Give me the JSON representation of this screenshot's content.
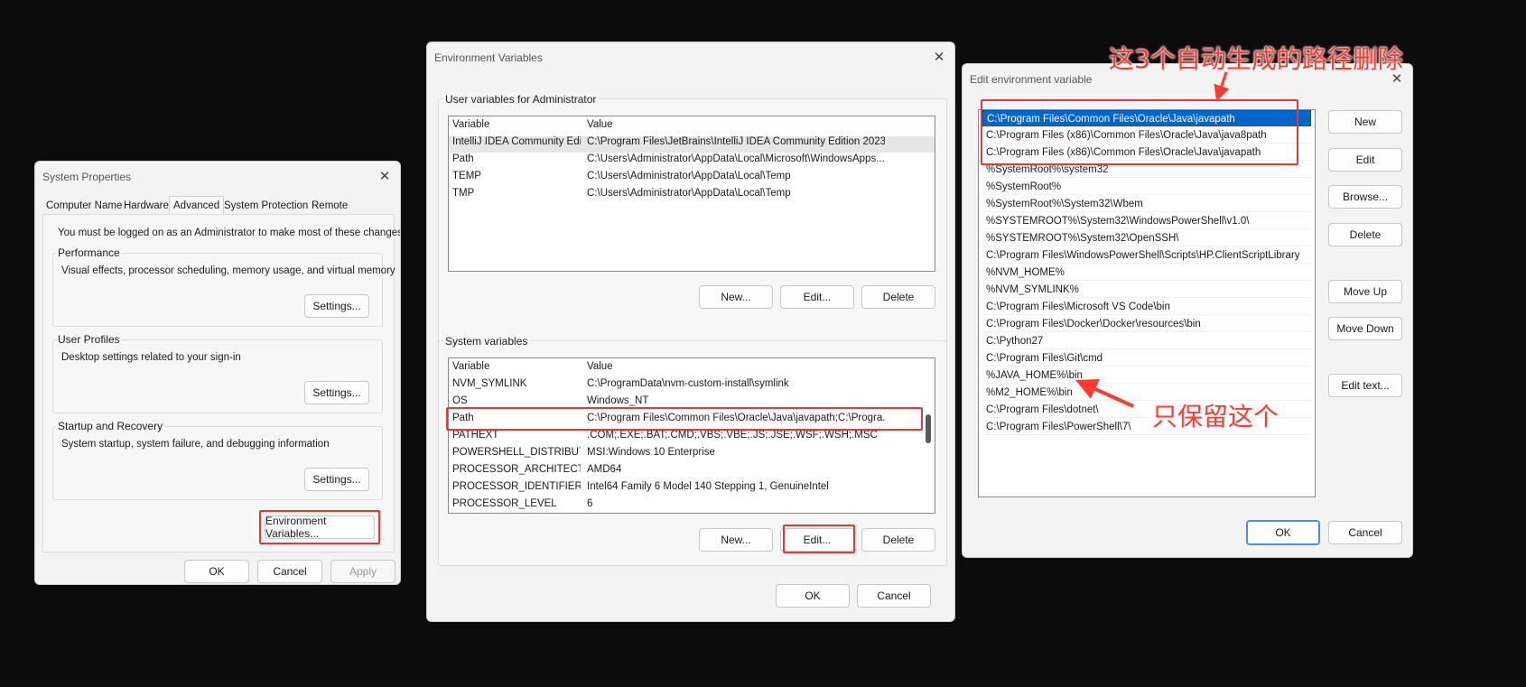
{
  "sys": {
    "title": "System Properties",
    "tabs": [
      "Computer Name",
      "Hardware",
      "Advanced",
      "System Protection",
      "Remote"
    ],
    "admin_note": "You must be logged on as an Administrator to make most of these changes.",
    "perf_label": "Performance",
    "perf_desc": "Visual effects, processor scheduling, memory usage, and virtual memory",
    "profiles_label": "User Profiles",
    "profiles_desc": "Desktop settings related to your sign-in",
    "startup_label": "Startup and Recovery",
    "startup_desc": "System startup, system failure, and debugging information",
    "settings": "Settings...",
    "env_button": "Environment Variables...",
    "ok": "OK",
    "cancel": "Cancel",
    "apply": "Apply"
  },
  "env": {
    "title": "Environment Variables",
    "user_label": "User variables for Administrator",
    "col_variable": "Variable",
    "col_value": "Value",
    "user_vars": [
      {
        "name": "IntelliJ IDEA Community Edi...",
        "value": "C:\\Program Files\\JetBrains\\IntelliJ IDEA Community Edition 2023...."
      },
      {
        "name": "Path",
        "value": "C:\\Users\\Administrator\\AppData\\Local\\Microsoft\\WindowsApps..."
      },
      {
        "name": "TEMP",
        "value": "C:\\Users\\Administrator\\AppData\\Local\\Temp"
      },
      {
        "name": "TMP",
        "value": "C:\\Users\\Administrator\\AppData\\Local\\Temp"
      }
    ],
    "sys_label": "System variables",
    "sys_vars": [
      {
        "name": "NVM_SYMLINK",
        "value": "C:\\ProgramData\\nvm-custom-install\\symlink"
      },
      {
        "name": "OS",
        "value": "Windows_NT"
      },
      {
        "name": "Path",
        "value": "C:\\Program Files\\Common Files\\Oracle\\Java\\javapath;C:\\Progra..."
      },
      {
        "name": "PATHEXT",
        "value": ".COM;.EXE;.BAT;.CMD;.VBS;.VBE;.JS;.JSE;.WSF;.WSH;.MSC"
      },
      {
        "name": "POWERSHELL_DISTRIBUTIO...",
        "value": "MSI:Windows 10 Enterprise"
      },
      {
        "name": "PROCESSOR_ARCHITECTURE",
        "value": "AMD64"
      },
      {
        "name": "PROCESSOR_IDENTIFIER",
        "value": "Intel64 Family 6 Model 140 Stepping 1, GenuineIntel"
      },
      {
        "name": "PROCESSOR_LEVEL",
        "value": "6"
      }
    ],
    "new": "New...",
    "edit": "Edit...",
    "delete": "Delete",
    "ok": "OK",
    "cancel": "Cancel"
  },
  "edit": {
    "title": "Edit environment variable",
    "entries": [
      "C:\\Program Files\\Common Files\\Oracle\\Java\\javapath",
      "C:\\Program Files (x86)\\Common Files\\Oracle\\Java\\java8path",
      "C:\\Program Files (x86)\\Common Files\\Oracle\\Java\\javapath",
      "%SystemRoot%\\system32",
      "%SystemRoot%",
      "%SystemRoot%\\System32\\Wbem",
      "%SYSTEMROOT%\\System32\\WindowsPowerShell\\v1.0\\",
      "%SYSTEMROOT%\\System32\\OpenSSH\\",
      "C:\\Program Files\\WindowsPowerShell\\Scripts\\HP.ClientScriptLibrary",
      "%NVM_HOME%",
      "%NVM_SYMLINK%",
      "C:\\Program Files\\Microsoft VS Code\\bin",
      "C:\\Program Files\\Docker\\Docker\\resources\\bin",
      "C:\\Python27",
      "C:\\Program Files\\Git\\cmd",
      "%JAVA_HOME%\\bin",
      "%M2_HOME%\\bin",
      "C:\\Program Files\\dotnet\\",
      "C:\\Program Files\\PowerShell\\7\\"
    ],
    "buttons": [
      "New",
      "Edit",
      "Browse...",
      "Delete",
      "Move Up",
      "Move Down",
      "Edit text..."
    ],
    "ok": "OK",
    "cancel": "Cancel"
  },
  "annotations": {
    "delete_note": "这3个自动生成的路径删除",
    "keep_note": "只保留这个",
    "color": "#ff3b30"
  }
}
